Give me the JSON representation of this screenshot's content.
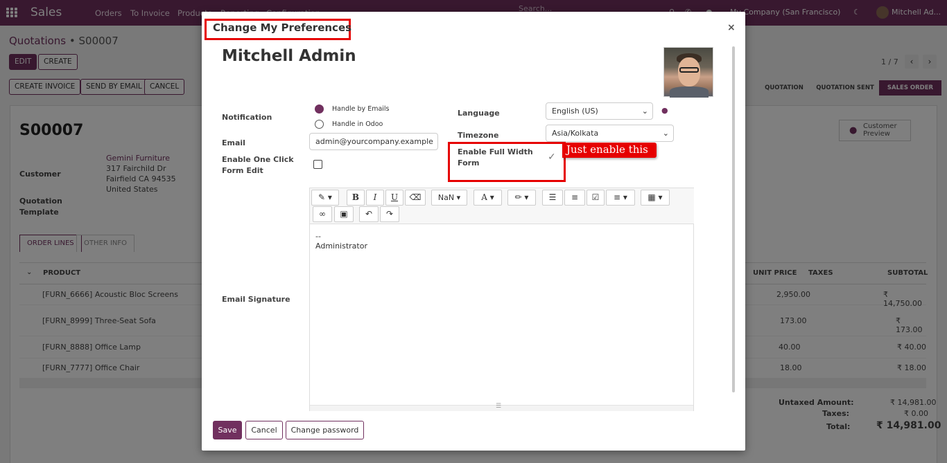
{
  "navbar": {
    "brand": "Sales",
    "menu": [
      "Orders",
      "To Invoice",
      "Products",
      "Reporting",
      "Configuration"
    ],
    "search_placeholder": "Search...",
    "company": "My Company (San Francisco)",
    "user": "Mitchell Ad..."
  },
  "background": {
    "breadcrumb_parent": "Quotations",
    "breadcrumb_current": "S00007",
    "buttons": {
      "edit": "EDIT",
      "create": "CREATE",
      "create_invoice": "CREATE INVOICE",
      "send_by_email": "SEND BY EMAIL",
      "cancel": "CANCEL"
    },
    "pager": "1 / 7",
    "stages": [
      "QUOTATION",
      "QUOTATION SENT",
      "SALES ORDER"
    ],
    "record_name": "S00007",
    "customer_label": "Customer",
    "customer_name": "Gemini Furniture",
    "address": [
      "317 Fairchild Dr",
      "Fairfield CA 94535",
      "United States"
    ],
    "template_label": "Quotation Template",
    "preview_label": "Customer Preview",
    "tabs": [
      "ORDER LINES",
      "OTHER INFO"
    ],
    "columns": {
      "product": "PRODUCT",
      "unit_price": "UNIT PRICE",
      "taxes": "TAXES",
      "subtotal": "SUBTOTAL"
    },
    "rows": [
      {
        "product": "[FURN_6666] Acoustic Bloc Screens",
        "unit_price": "2,950.00",
        "subtotal": "₹ 14,750.00"
      },
      {
        "product": "[FURN_8999] Three-Seat Sofa",
        "unit_price": "173.00",
        "subtotal": "₹ 173.00"
      },
      {
        "product": "[FURN_8888] Office Lamp",
        "unit_price": "40.00",
        "subtotal": "₹ 40.00"
      },
      {
        "product": "[FURN_7777] Office Chair",
        "unit_price": "18.00",
        "subtotal": "₹ 18.00"
      }
    ],
    "totals": {
      "untaxed_label": "Untaxed Amount:",
      "untaxed": "₹ 14,981.00",
      "taxes_label": "Taxes:",
      "taxes": "₹ 0.00",
      "total_label": "Total:",
      "total": "₹ 14,981.00"
    }
  },
  "modal": {
    "title": "Change My Preferences",
    "user_name": "Mitchell Admin",
    "notification_label": "Notification",
    "notification_options": [
      "Handle by Emails",
      "Handle in Odoo"
    ],
    "email_label": "Email",
    "email_value": "admin@yourcompany.example",
    "one_click_label": "Enable One Click Form Edit",
    "language_label": "Language",
    "language_value": "English (US)",
    "timezone_label": "Timezone",
    "timezone_value": "Asia/Kolkata",
    "full_width_label": "Enable Full Width Form",
    "callout": "Just enable this",
    "toolbar_font_size": "NaN",
    "signature_label": "Email Signature",
    "signature_lines": [
      "--",
      "Administrator"
    ],
    "buttons": {
      "save": "Save",
      "cancel": "Cancel",
      "change_password": "Change password"
    }
  },
  "colors": {
    "brand": "#71305f",
    "highlight": "#e60000"
  }
}
